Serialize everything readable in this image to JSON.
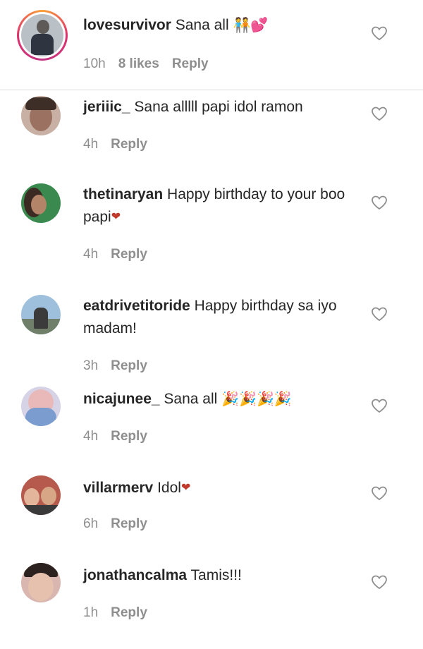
{
  "comments": [
    {
      "username": "lovesurvivor",
      "text": "Sana all",
      "emoji": "🧑‍🤝‍🧑💕",
      "time": "10h",
      "likes": "8 likes",
      "reply": "Reply"
    },
    {
      "username": "jeriiic_",
      "text": "Sana alllll papi idol ramon",
      "emoji": "",
      "time": "4h",
      "likes": "",
      "reply": "Reply"
    },
    {
      "username": "thetinaryan",
      "text": "Happy birthday to your boo papi",
      "emoji": "❤",
      "time": "4h",
      "likes": "",
      "reply": "Reply"
    },
    {
      "username": "eatdrivetitoride",
      "text": "Happy birthday sa iyo madam!",
      "emoji": "",
      "time": "3h",
      "likes": "",
      "reply": "Reply"
    },
    {
      "username": "nicajunee_",
      "text": "Sana all",
      "emoji": "🎉🎉🎉🎉",
      "time": "4h",
      "likes": "",
      "reply": "Reply"
    },
    {
      "username": "villarmerv",
      "text": "Idol",
      "emoji": "❤",
      "time": "6h",
      "likes": "",
      "reply": "Reply"
    },
    {
      "username": "jonathancalma",
      "text": "Tamis!!!",
      "emoji": "",
      "time": "1h",
      "likes": "",
      "reply": "Reply"
    }
  ],
  "colors": {
    "text": "#262626",
    "meta": "#8e8e8e",
    "divider": "#dbdbdb",
    "heart": "#8e8e8e"
  },
  "icons": {
    "like": "heart-outline-icon",
    "avatar": "user-avatar"
  }
}
